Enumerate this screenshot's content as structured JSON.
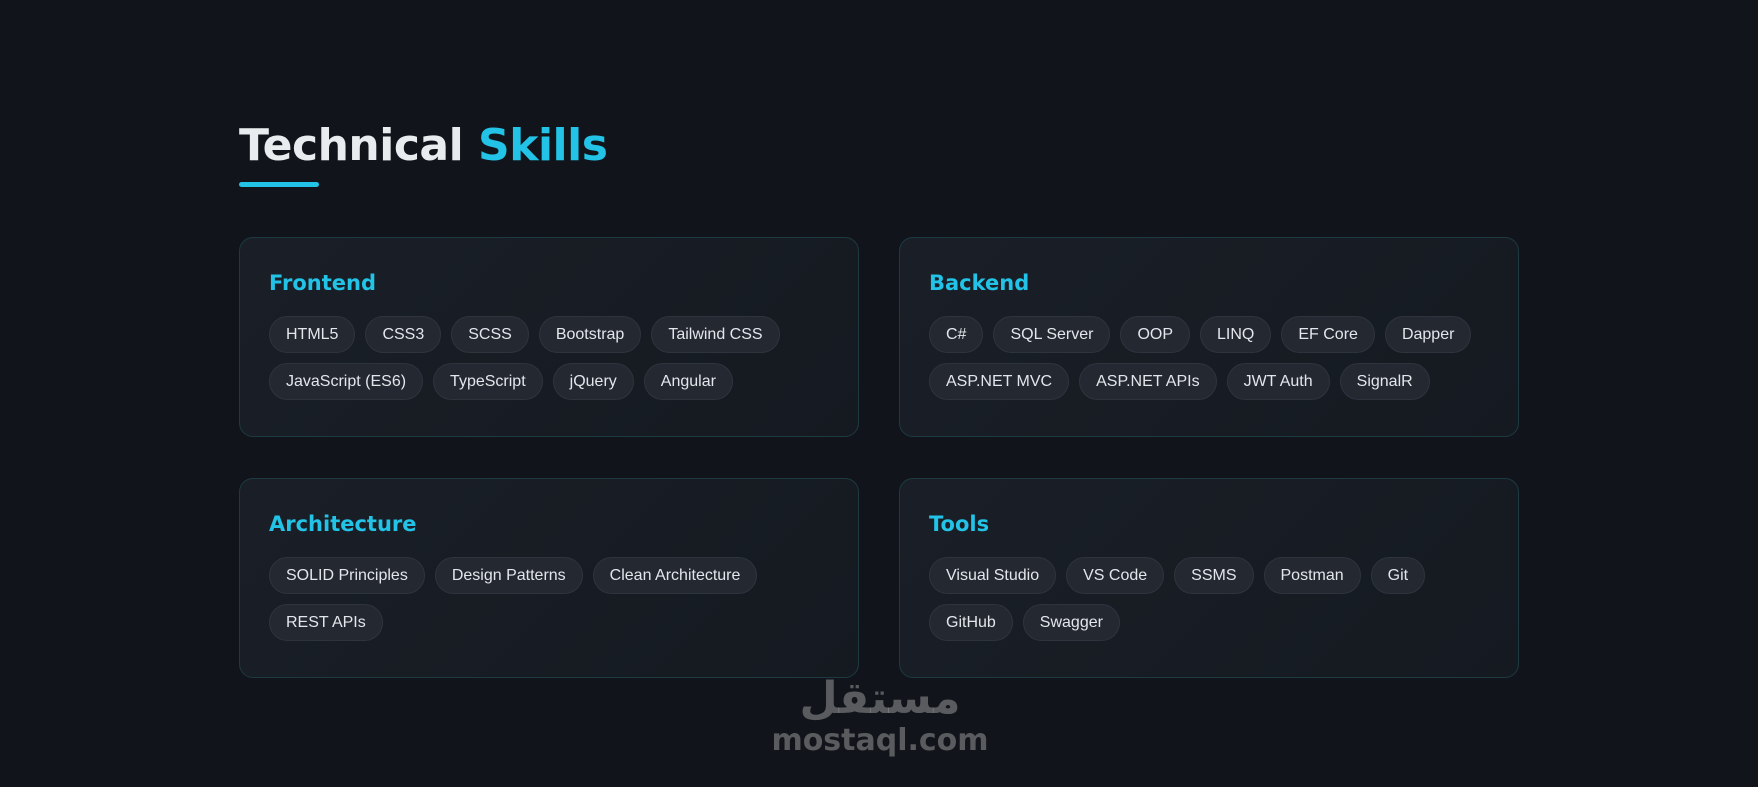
{
  "section": {
    "title_main": "Technical",
    "title_accent": "Skills"
  },
  "cards": [
    {
      "title": "Frontend",
      "chips": [
        "HTML5",
        "CSS3",
        "SCSS",
        "Bootstrap",
        "Tailwind CSS",
        "JavaScript (ES6)",
        "TypeScript",
        "jQuery",
        "Angular"
      ]
    },
    {
      "title": "Backend",
      "chips": [
        "C#",
        "SQL Server",
        "OOP",
        "LINQ",
        "EF Core",
        "Dapper",
        "ASP.NET MVC",
        "ASP.NET APIs",
        "JWT Auth",
        "SignalR"
      ]
    },
    {
      "title": "Architecture",
      "chips": [
        "SOLID Principles",
        "Design Patterns",
        "Clean Architecture",
        "REST APIs"
      ]
    },
    {
      "title": "Tools",
      "chips": [
        "Visual Studio",
        "VS Code",
        "SSMS",
        "Postman",
        "Git",
        "GitHub",
        "Swagger"
      ]
    }
  ],
  "watermark": {
    "arabic": "مستقل",
    "domain": "mostaql.com"
  },
  "colors": {
    "background": "#11151b",
    "accent": "#22c3e6",
    "card_border": "#1c3a40",
    "chip_bg": "#232831"
  }
}
